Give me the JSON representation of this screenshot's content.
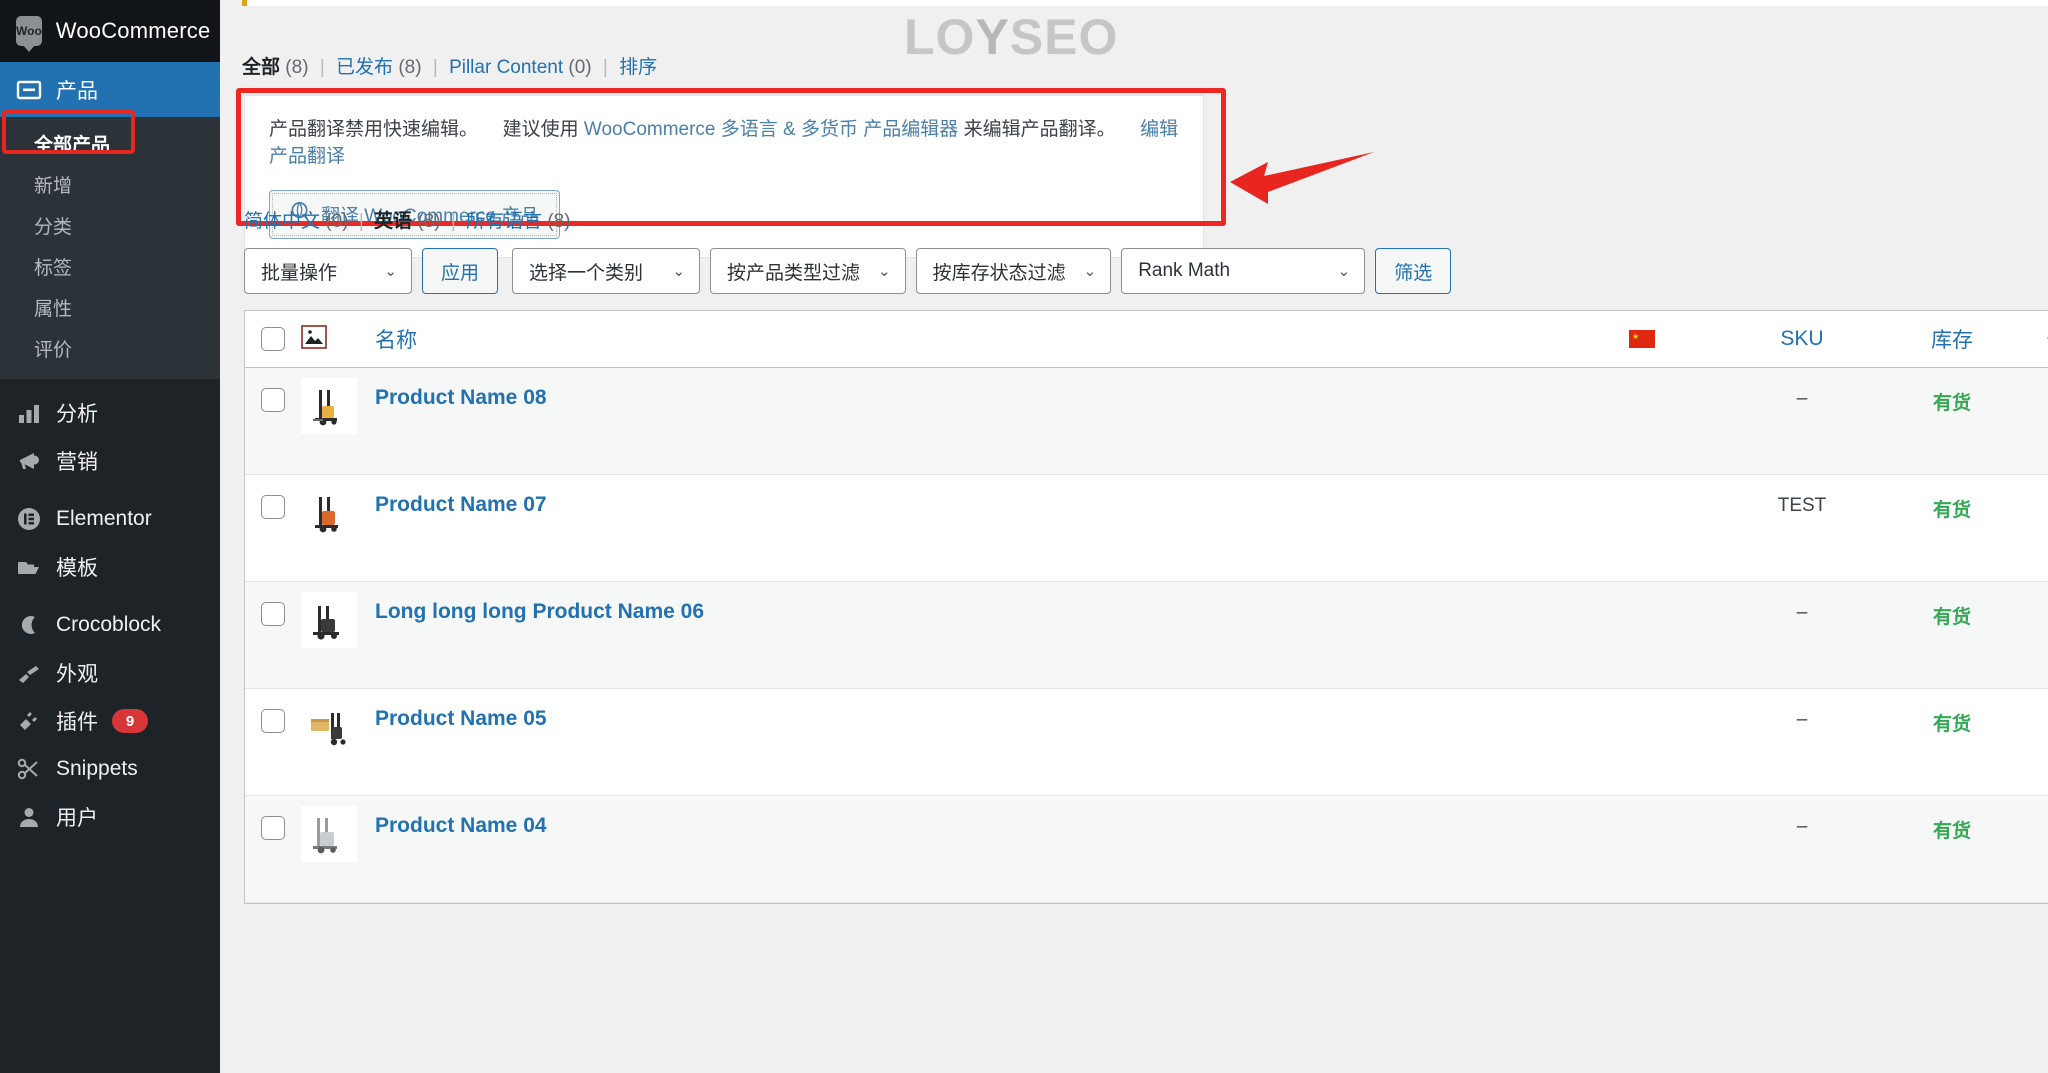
{
  "sidebar": {
    "brand": {
      "logo_text": "Woo",
      "title": "WooCommerce",
      "alert_badge": "!"
    },
    "current_menu": {
      "label": "产品",
      "icon": "products-icon"
    },
    "submenu": [
      {
        "label": "全部产品",
        "current": true
      },
      {
        "label": "新增",
        "current": false
      },
      {
        "label": "分类",
        "current": false
      },
      {
        "label": "标签",
        "current": false
      },
      {
        "label": "属性",
        "current": false
      },
      {
        "label": "评价",
        "current": false
      }
    ],
    "items": [
      {
        "label": "分析",
        "icon": "chart-bar-icon",
        "badge": ""
      },
      {
        "label": "营销",
        "icon": "megaphone-icon",
        "badge": ""
      },
      {
        "label": "Elementor",
        "icon": "elementor-icon",
        "badge": ""
      },
      {
        "label": "模板",
        "icon": "folder-icon",
        "badge": ""
      },
      {
        "label": "Crocoblock",
        "icon": "crocoblock-icon",
        "badge": ""
      },
      {
        "label": "外观",
        "icon": "paintbrush-icon",
        "badge": ""
      },
      {
        "label": "插件",
        "icon": "plug-icon",
        "badge": "9"
      },
      {
        "label": "Snippets",
        "icon": "scissors-icon",
        "badge": ""
      },
      {
        "label": "用户",
        "icon": "user-icon",
        "badge": ""
      }
    ]
  },
  "watermark": {
    "text_left": "LO",
    "text_mark": "Y",
    "text_right": "SEO"
  },
  "status_links": {
    "all": {
      "label": "全部",
      "count": "(8)"
    },
    "published": {
      "label": "已发布",
      "count": "(8)"
    },
    "pillar": {
      "label": "Pillar Content",
      "count": "(0)"
    },
    "sort": {
      "label": "排序"
    },
    "separator": "|"
  },
  "notice": {
    "text_before": "产品翻译禁用快速编辑。",
    "text_suggest": "建议使用",
    "link_editor": "WooCommerce 多语言 & 多货币 产品编辑器",
    "text_after": "来编辑产品翻译。",
    "link_edit_translation": "编辑产品翻译",
    "button_label": "翻译 WooCommerce 产品",
    "button_icon": "wpml-globe-icon"
  },
  "language_links": {
    "zh": {
      "label": "简体中文",
      "count": "(0)"
    },
    "en": {
      "label": "英语",
      "count": "(8)"
    },
    "all": {
      "label": "所有语言",
      "count": "(8)"
    },
    "separator": "|"
  },
  "toolbar": {
    "bulk_action": "批量操作",
    "apply": "应用",
    "category": "选择一个类别",
    "product_type": "按产品类型过滤",
    "stock_status": "按库存状态过滤",
    "rank_math": "Rank Math",
    "filter": "筛选",
    "chevron": "⌄"
  },
  "table": {
    "headers": {
      "checkbox": "select-all",
      "image": "image-icon",
      "name": "名称",
      "flag": "cn-flag",
      "sku": "SKU",
      "stock": "库存",
      "price": "价"
    },
    "rows": [
      {
        "name": "Product Name 08",
        "sku": "–",
        "stock": "有货",
        "price": "–",
        "thumb": "forklift-yellow"
      },
      {
        "name": "Product Name 07",
        "sku": "TEST",
        "stock": "有货",
        "price": "",
        "thumb": "forklift-orange"
      },
      {
        "name": "Long long long Product Name 06",
        "sku": "–",
        "stock": "有货",
        "price": "",
        "thumb": "forklift-dark"
      },
      {
        "name": "Product Name 05",
        "sku": "–",
        "stock": "有货",
        "price": "",
        "thumb": "forklift-pallet"
      },
      {
        "name": "Product Name 04",
        "sku": "–",
        "stock": "有货",
        "price": "",
        "thumb": "forklift-grey"
      }
    ]
  },
  "colors": {
    "sidebar_bg": "#1d2327",
    "sidebar_current": "#2271b1",
    "link": "#2271b1",
    "highlight_red": "#ee2722",
    "badge_red": "#d63638",
    "in_stock_green": "#34a853",
    "flag_red": "#de2910"
  }
}
